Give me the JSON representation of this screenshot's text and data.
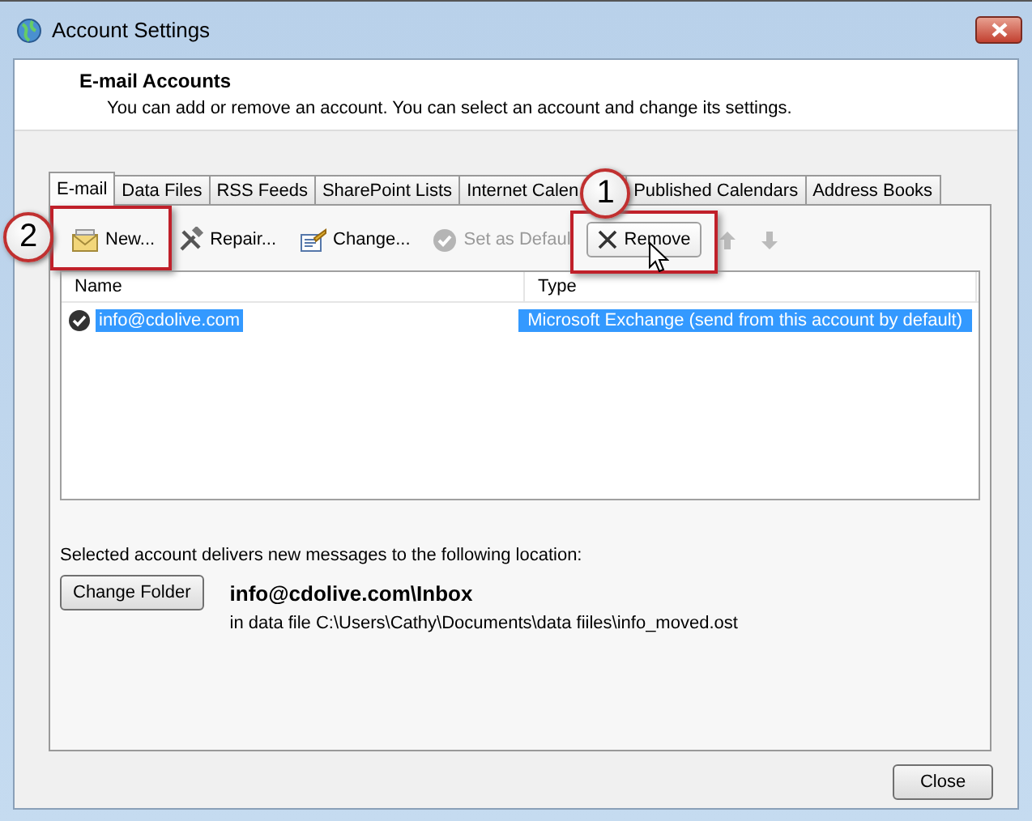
{
  "window": {
    "title": "Account Settings"
  },
  "header": {
    "title": "E-mail Accounts",
    "description": "You can add or remove an account. You can select an account and change its settings."
  },
  "tabs": [
    {
      "label": "E-mail",
      "selected": true
    },
    {
      "label": "Data Files",
      "selected": false
    },
    {
      "label": "RSS Feeds",
      "selected": false
    },
    {
      "label": "SharePoint Lists",
      "selected": false
    },
    {
      "label": "Internet Calen",
      "selected": false
    },
    {
      "label": "Published Calendars",
      "selected": false
    },
    {
      "label": "Address Books",
      "selected": false
    }
  ],
  "toolbar": [
    {
      "kind": "new",
      "label": "New...",
      "disabled": false
    },
    {
      "kind": "repair",
      "label": "Repair...",
      "disabled": false
    },
    {
      "kind": "change",
      "label": "Change...",
      "disabled": false
    },
    {
      "kind": "default",
      "label": "Set as Defaul",
      "disabled": true
    },
    {
      "kind": "remove",
      "label": "Remove",
      "disabled": false
    },
    {
      "kind": "up",
      "disabled": true
    },
    {
      "kind": "down",
      "disabled": true
    }
  ],
  "table": {
    "columns": [
      "Name",
      "Type"
    ],
    "rows": [
      {
        "name": "info@cdolive.com",
        "type": "Microsoft Exchange (send from this account by default)",
        "selected": true
      }
    ]
  },
  "delivery": {
    "description": "Selected account delivers new messages to the following location:",
    "button": "Change Folder",
    "folder": "info@cdolive.com\\Inbox",
    "data_file": "in data file C:\\Users\\Cathy\\Documents\\data fiiles\\info_moved.ost"
  },
  "buttons": [
    "Close"
  ],
  "callouts": [
    {
      "label": "1"
    },
    {
      "label": "2"
    }
  ]
}
